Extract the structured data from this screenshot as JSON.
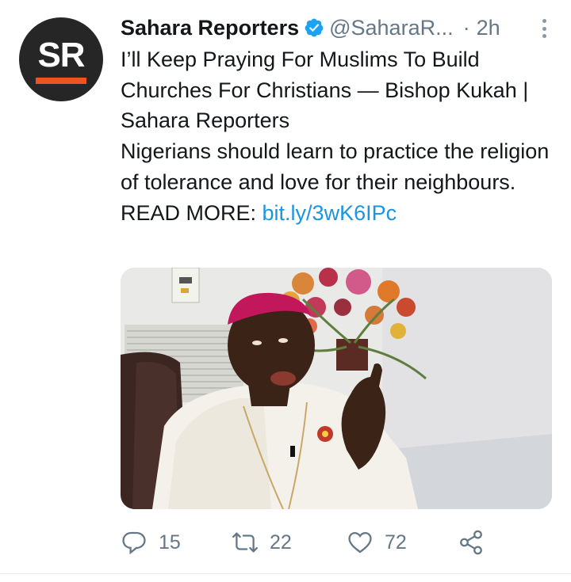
{
  "account": {
    "name": "Sahara Reporters",
    "handle": "@SaharaR...",
    "separator": "·",
    "time": "2h",
    "avatar_text": "SR",
    "avatar_bg": "#262626",
    "avatar_accent": "#ef5323",
    "verified_color": "#1da1f2"
  },
  "tweet": {
    "headline": "I’ll Keep Praying For Muslims To Build Churches For Christians — Bishop Kukah | Sahara Reporters",
    "summary": "Nigerians should learn to practice the religion of tolerance and love for their neighbours.",
    "read_more_label": "READ MORE: ",
    "link_text": "bit.ly/3wK6IPc",
    "link_color": "#1b95e0"
  },
  "media": {
    "icon": "photo-of-bishop-speaking"
  },
  "actions": {
    "reply_count": "15",
    "retweet_count": "22",
    "like_count": "72",
    "icon_color": "#657786"
  }
}
